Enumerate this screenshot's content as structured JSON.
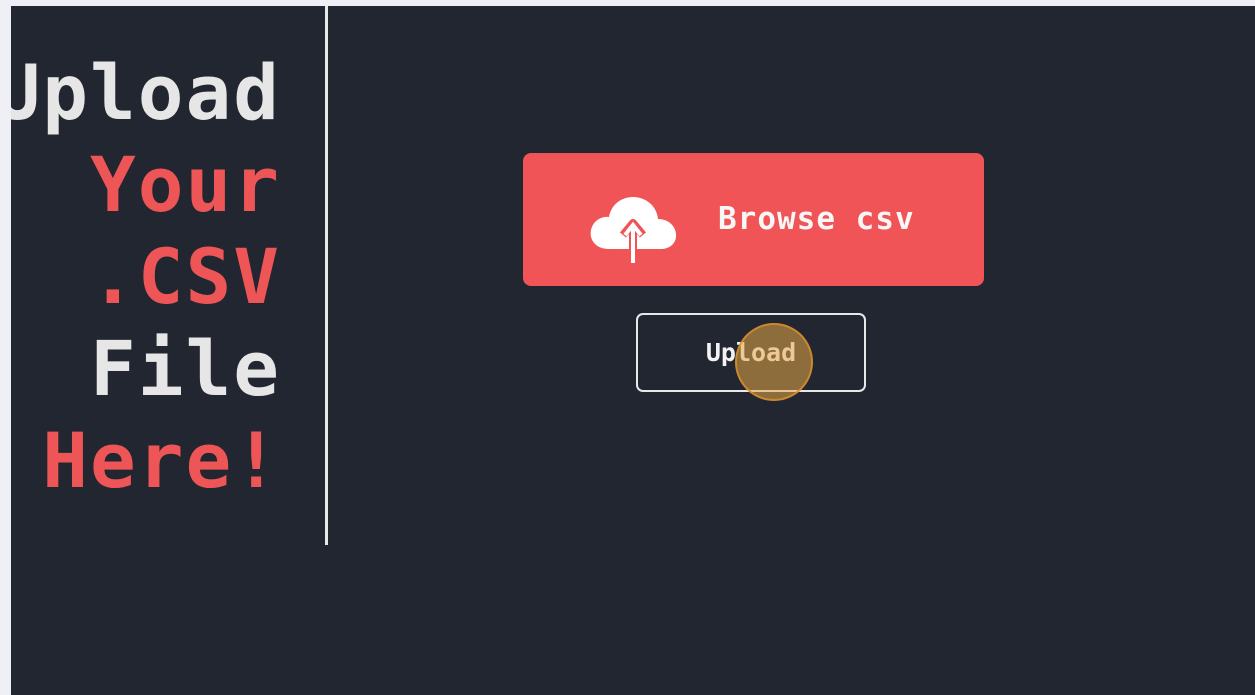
{
  "heading": {
    "lines": [
      {
        "text": "Upload",
        "color": "#e6e6e6"
      },
      {
        "text": "Your",
        "color": "#ee5556"
      },
      {
        "text": ".CSV",
        "color": "#ee5556"
      },
      {
        "text": "File",
        "color": "#e6e6e6"
      },
      {
        "text": "Here!",
        "color": "#ee5556"
      }
    ]
  },
  "browse_button": {
    "label": "Browse csv",
    "icon": "cloud-upload-icon",
    "background": "#f05457",
    "text_color": "#f7f7f7"
  },
  "upload_button": {
    "label": "Upload"
  },
  "colors": {
    "background": "#222630",
    "outer_margin": "#eef0f6",
    "divider": "#e8e8e8",
    "cursor_highlight": "#e8a848"
  }
}
